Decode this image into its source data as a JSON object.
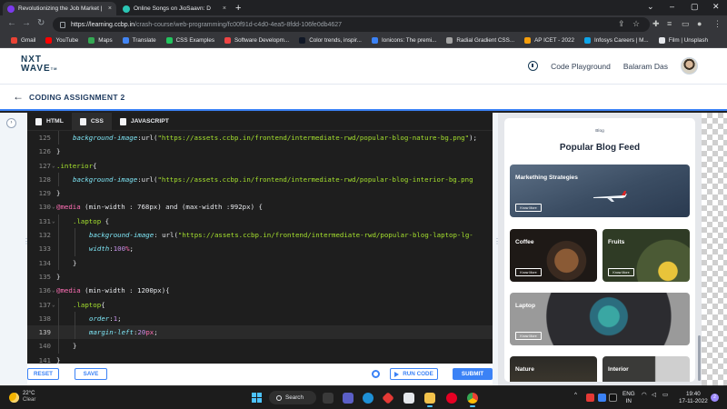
{
  "browser": {
    "tabs": [
      {
        "title": "Revolutionizing the Job Market | ",
        "close": "×",
        "color": "#7c3aed"
      },
      {
        "title": "Online Songs on JioSaavn: D",
        "close": "×",
        "color": "#2bc5b4"
      }
    ],
    "new_tab": "+",
    "window_controls": [
      "⌄",
      "–",
      "▢",
      "✕"
    ],
    "url_host": "https://learning.ccbp.in",
    "url_path": "/crash-course/web-programming/fc00f91d-c4d0-4ea5-8fdd-106fe0db4627",
    "bookmarks": [
      {
        "label": "Gmail",
        "color": "#ea4335"
      },
      {
        "label": "YouTube",
        "color": "#ff0000"
      },
      {
        "label": "Maps",
        "color": "#34a853"
      },
      {
        "label": "Translate",
        "color": "#4285f4"
      },
      {
        "label": "CSS Examples",
        "color": "#22c55e"
      },
      {
        "label": "Software Developm...",
        "color": "#ef4444"
      },
      {
        "label": "Color trends, inspir...",
        "color": "#111827"
      },
      {
        "label": "Ionicons: The premi...",
        "color": "#3b82f6"
      },
      {
        "label": "Radial Gradient CSS...",
        "color": "#a3a3a3"
      },
      {
        "label": "AP ICET - 2022",
        "color": "#f59e0b"
      },
      {
        "label": "Infosys Careers | M...",
        "color": "#0ea5e9"
      },
      {
        "label": "Film | Unsplash",
        "color": "#e5e7eb"
      }
    ]
  },
  "header": {
    "logo_line1": "NXT",
    "logo_line2": "WAVE",
    "logo_tm": "TM",
    "code_playground": "Code Playground",
    "user_name": "Balaram Das"
  },
  "subheader": {
    "back": "←",
    "title": "CODING ASSIGNMENT 2",
    "collapse": "›"
  },
  "editor": {
    "tabs": [
      "HTML",
      "CSS",
      "JAVASCRIPT"
    ],
    "active_tab": "CSS",
    "lines": [
      {
        "n": "125",
        "indent": 1,
        "fold": false,
        "cur": false,
        "tokens": [
          [
            "prop",
            "background-image"
          ],
          [
            "pl",
            ":url("
          ],
          [
            "str",
            "\"https://assets.ccbp.in/frontend/intermediate-rwd/popular-blog-nature-bg.png\""
          ],
          [
            "pl",
            ");"
          ]
        ]
      },
      {
        "n": "126",
        "indent": 0,
        "fold": false,
        "cur": false,
        "tokens": [
          [
            "pl",
            "}"
          ]
        ]
      },
      {
        "n": "127",
        "indent": 0,
        "fold": true,
        "cur": false,
        "tokens": [
          [
            "sel",
            ".interior"
          ],
          [
            "pl",
            "{"
          ]
        ]
      },
      {
        "n": "128",
        "indent": 1,
        "fold": false,
        "cur": false,
        "tokens": [
          [
            "prop",
            "background-image"
          ],
          [
            "pl",
            ":url("
          ],
          [
            "str",
            "\"https://assets.ccbp.in/frontend/intermediate-rwd/popular-blog-interior-bg.png"
          ]
        ]
      },
      {
        "n": "129",
        "indent": 0,
        "fold": false,
        "cur": false,
        "tokens": [
          [
            "pl",
            "}"
          ]
        ]
      },
      {
        "n": "130",
        "indent": 0,
        "fold": true,
        "cur": false,
        "tokens": [
          [
            "at",
            "@media"
          ],
          [
            "pl",
            " (min-width : 768px) and (max-width :992px) {"
          ]
        ]
      },
      {
        "n": "131",
        "indent": 1,
        "fold": true,
        "cur": false,
        "tokens": [
          [
            "sel",
            ".laptop"
          ],
          [
            "pl",
            " {"
          ]
        ]
      },
      {
        "n": "132",
        "indent": 2,
        "fold": false,
        "cur": false,
        "tokens": [
          [
            "prop",
            "background-image"
          ],
          [
            "pl",
            ": url("
          ],
          [
            "str",
            "\"https://assets.ccbp.in/frontend/intermediate-rwd/popular-blog-laptop-lg-"
          ]
        ]
      },
      {
        "n": "133",
        "indent": 2,
        "fold": false,
        "cur": false,
        "tokens": [
          [
            "prop",
            "width"
          ],
          [
            "pl",
            ":"
          ],
          [
            "num",
            "100"
          ],
          [
            "unit",
            "%"
          ],
          [
            "pl",
            ";"
          ]
        ]
      },
      {
        "n": "134",
        "indent": 1,
        "fold": false,
        "cur": false,
        "tokens": [
          [
            "pl",
            "}"
          ]
        ]
      },
      {
        "n": "135",
        "indent": 0,
        "fold": false,
        "cur": false,
        "tokens": [
          [
            "pl",
            "}"
          ]
        ]
      },
      {
        "n": "136",
        "indent": 0,
        "fold": true,
        "cur": false,
        "tokens": [
          [
            "at",
            "@media"
          ],
          [
            "pl",
            " (min-width : 1200px){"
          ]
        ]
      },
      {
        "n": "137",
        "indent": 1,
        "fold": true,
        "cur": false,
        "tokens": [
          [
            "sel",
            ".laptop"
          ],
          [
            "pl",
            "{"
          ]
        ]
      },
      {
        "n": "138",
        "indent": 2,
        "fold": false,
        "cur": false,
        "tokens": [
          [
            "prop",
            "order"
          ],
          [
            "pl",
            ":"
          ],
          [
            "num",
            "1"
          ],
          [
            "pl",
            ";"
          ]
        ]
      },
      {
        "n": "139",
        "indent": 2,
        "fold": false,
        "cur": true,
        "tokens": [
          [
            "prop",
            "margin-left"
          ],
          [
            "pl",
            ":"
          ],
          [
            "num",
            "20"
          ],
          [
            "unit",
            "px"
          ],
          [
            "pl",
            ";"
          ]
        ]
      },
      {
        "n": "140",
        "indent": 1,
        "fold": false,
        "cur": false,
        "tokens": [
          [
            "pl",
            "}"
          ]
        ]
      },
      {
        "n": "141",
        "indent": 0,
        "fold": false,
        "cur": false,
        "tokens": [
          [
            "pl",
            "}"
          ]
        ]
      }
    ]
  },
  "actions": {
    "reset": "RESET",
    "save": "SAVE",
    "run_code": "RUN CODE",
    "submit": "SUBMIT"
  },
  "preview": {
    "small_label": "Blog",
    "title": "Popular Blog Feed",
    "button_label": "Know More",
    "cards": [
      {
        "label": "Markething Strategies",
        "bg": "linear-gradient(160deg,#5c6f85 0%,#3b4d63 55%,#2a3a50 100%)"
      },
      {
        "label": "Coffee",
        "bg": "radial-gradient(circle at 65% 60%,#8a5a35 0 18%,#3a2a20 19% 30%,#1e1916 31%)"
      },
      {
        "label": "Fruits",
        "bg": "radial-gradient(circle at 75% 80%,#e9c43a 0 12%,#4b5a35 13% 40%,#2f3b25 41%)"
      },
      {
        "label": "Laptop",
        "bg": "radial-gradient(circle at 55% 45%,#3aa7a3 0 10%,#2b6d7e 11% 18%,#2c2c30 19% 60%,#9a9a9a 61%)"
      },
      {
        "label": "Nature",
        "bg": "linear-gradient(180deg,#2b2a26,#4a4234)"
      },
      {
        "label": "Interior",
        "bg": "linear-gradient(90deg,#3a3a38 0 60%,#cfcfcf 61%)"
      }
    ]
  },
  "taskbar": {
    "temperature": "22°C",
    "condition": "Clear",
    "search": "Search",
    "tray_up": "^",
    "lang1": "ENG",
    "lang2": "IN",
    "time": "19:40",
    "date": "17-11-2022",
    "notification_count": "2"
  }
}
